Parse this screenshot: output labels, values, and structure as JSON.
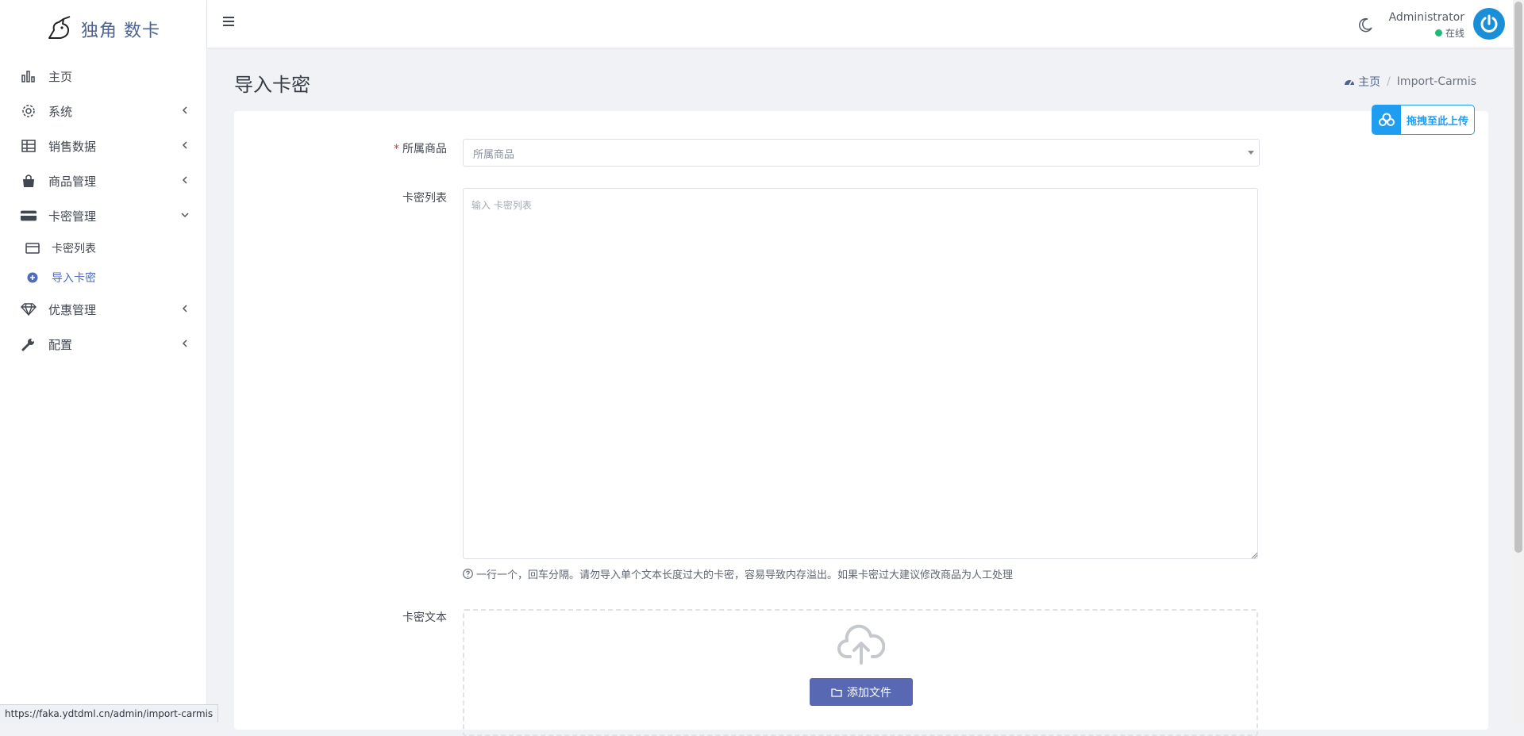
{
  "brand": {
    "name": "独角 数卡"
  },
  "sidebar": {
    "items": [
      {
        "label": "主页",
        "icon": "bar-chart-icon"
      },
      {
        "label": "系统",
        "icon": "gear-icon"
      },
      {
        "label": "销售数据",
        "icon": "table-icon"
      },
      {
        "label": "商品管理",
        "icon": "shopping-bag-icon"
      },
      {
        "label": "卡密管理",
        "icon": "credit-card-icon"
      },
      {
        "label": "优惠管理",
        "icon": "diamond-icon"
      },
      {
        "label": "配置",
        "icon": "wrench-icon"
      }
    ],
    "sub_items": [
      {
        "label": "卡密列表",
        "icon": "card-icon"
      },
      {
        "label": "导入卡密",
        "icon": "plus-circle-icon",
        "active": true
      }
    ]
  },
  "header": {
    "user_name": "Administrator",
    "user_status": "在线"
  },
  "page": {
    "title": "导入卡密",
    "breadcrumb_home": "主页",
    "breadcrumb_current": "Import-Carmis"
  },
  "float_upload": {
    "label": "拖拽至此上传"
  },
  "form": {
    "product_label": "所属商品",
    "product_placeholder": "所属商品",
    "list_label": "卡密列表",
    "list_placeholder": "输入 卡密列表",
    "help_text": "一行一个，回车分隔。请勿导入单个文本长度过大的卡密，容易导致内存溢出。如果卡密过大建议修改商品为人工处理",
    "file_label": "卡密文本",
    "add_file_label": "添加文件"
  },
  "status_bar": {
    "url": "https://faka.ydtdml.cn/admin/import-carmis"
  },
  "colors": {
    "accent": "#5968b2",
    "brand": "#4e6394",
    "upload": "#1e9df1",
    "online": "#21b978"
  }
}
